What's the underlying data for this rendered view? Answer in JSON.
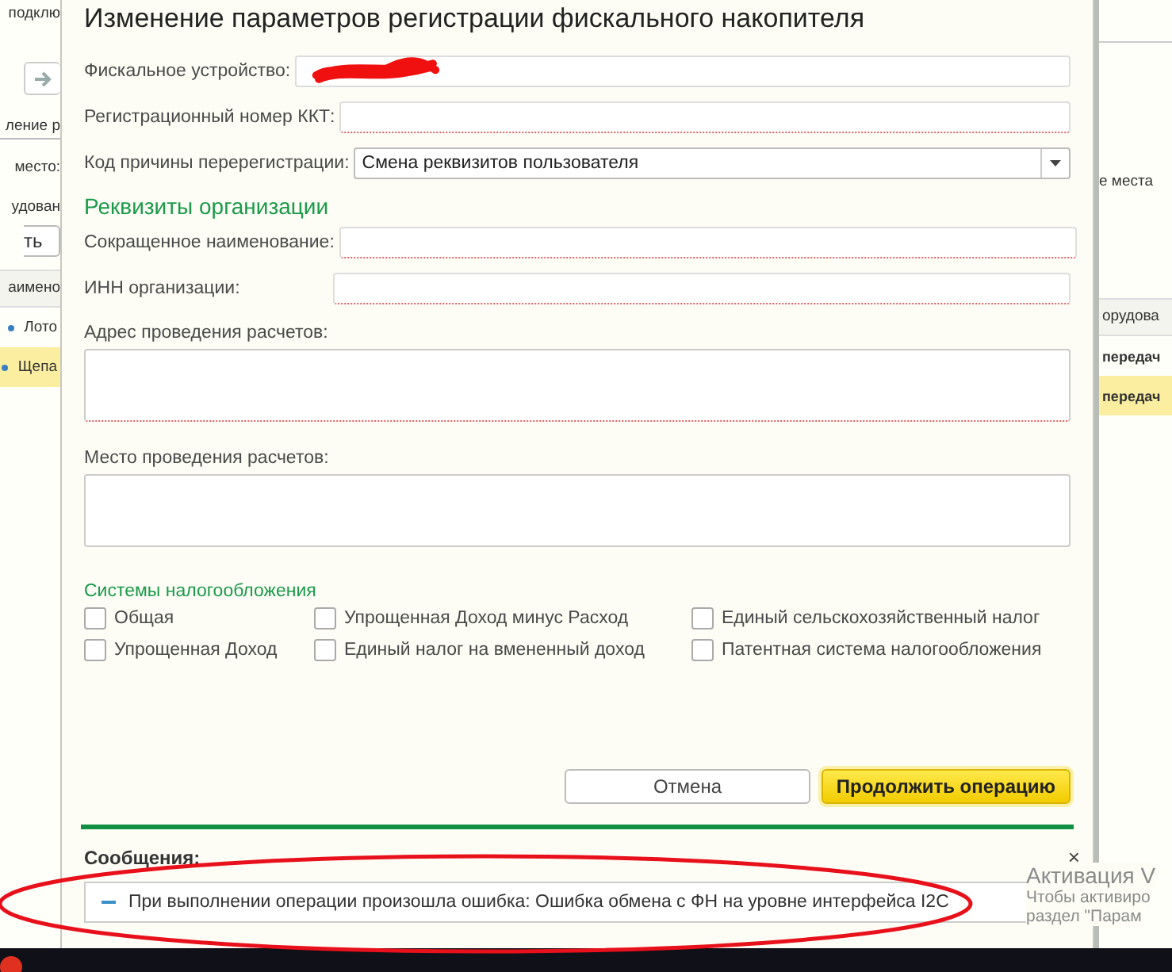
{
  "background_app": {
    "top_label": "подклю",
    "tab_fragment": "ление р",
    "place_label_left": "место:",
    "place_label_right": "е места",
    "equipment_label": "удован",
    "button_fragment": "ть",
    "columns": [
      "аимено",
      "орудова"
    ],
    "rows": [
      {
        "cells": [
          "Лото",
          "передач"
        ],
        "selected": false
      },
      {
        "cells": [
          "Щепа",
          "передач"
        ],
        "selected": true
      }
    ]
  },
  "dialog": {
    "title": "Изменение параметров регистрации фискального накопителя",
    "fields": [
      {
        "label": "Фискальное устройство:",
        "kind": "text",
        "redacted": true,
        "required": false
      },
      {
        "label": "Регистрационный номер ККТ:",
        "kind": "text",
        "redacted": false,
        "required": true
      },
      {
        "label": "Код причины перерегистрации:",
        "kind": "select",
        "value": "Смена реквизитов пользователя",
        "redacted": false,
        "required": false
      }
    ],
    "organization": {
      "title": "Реквизиты организации",
      "fields": [
        {
          "label": "Сокращенное наименование:",
          "required": true
        },
        {
          "label": "ИНН организации:",
          "required": true
        }
      ],
      "areas": [
        {
          "label": "Адрес проведения расчетов:",
          "required": true
        },
        {
          "label": "Место проведения расчетов:",
          "required": false
        }
      ]
    },
    "tax_systems": {
      "title": "Системы налогообложения",
      "options": [
        {
          "label": "Общая",
          "checked": false
        },
        {
          "label": "Упрощенная Доход минус Расход",
          "checked": false
        },
        {
          "label": "Единый сельскохозяйственный налог",
          "checked": false
        },
        {
          "label": "Упрощенная Доход",
          "checked": false
        },
        {
          "label": "Единый налог на вмененный доход",
          "checked": false
        },
        {
          "label": "Патентная система налогообложения",
          "checked": false
        }
      ]
    },
    "buttons": [
      {
        "label": "Отмена",
        "kind": "secondary"
      },
      {
        "label": "Продолжить операцию",
        "kind": "primary"
      }
    ],
    "messages": {
      "title": "Сообщения:",
      "close": "×",
      "items": [
        "При выполнении операции произошла ошибка: Ошибка обмена с ФН на уровне интерфейса I2C"
      ]
    }
  },
  "os_watermark": [
    "Активация V",
    "Чтобы активиро",
    "раздел \"Парам"
  ]
}
